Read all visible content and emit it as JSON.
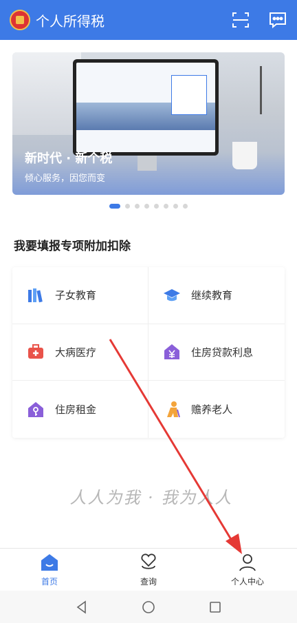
{
  "header": {
    "title": "个人所得税",
    "icons": [
      "emblem-icon",
      "scan-icon",
      "message-icon"
    ]
  },
  "banner": {
    "title": "新时代 · 新个税",
    "subtitle": "倾心服务，因您而变",
    "page_count": 8,
    "active_page": 1
  },
  "section": {
    "title": "我要填报专项附加扣除"
  },
  "deductions": [
    {
      "label": "子女教育",
      "icon": "books-icon",
      "color": "#3d7ae6"
    },
    {
      "label": "继续教育",
      "icon": "graduation-cap-icon",
      "color": "#3d7ae6"
    },
    {
      "label": "大病医疗",
      "icon": "medical-kit-icon",
      "color": "#e9534a"
    },
    {
      "label": "住房贷款利息",
      "icon": "house-yuan-icon",
      "color": "#8a5fd9"
    },
    {
      "label": "住房租金",
      "icon": "house-key-icon",
      "color": "#8a5fd9"
    },
    {
      "label": "赡养老人",
      "icon": "elderly-icon",
      "color": "#f3a43b"
    }
  ],
  "slogan": "人人为我 · 我为人人",
  "tabs": [
    {
      "label": "首页",
      "icon": "home-icon",
      "active": true
    },
    {
      "label": "查询",
      "icon": "search-heart-icon",
      "active": false
    },
    {
      "label": "个人中心",
      "icon": "person-icon",
      "active": false
    }
  ],
  "system_nav": [
    "back-icon",
    "home-circle-icon",
    "recents-icon"
  ],
  "colors": {
    "primary": "#3d7ae6",
    "annotation_arrow": "#e53935"
  }
}
